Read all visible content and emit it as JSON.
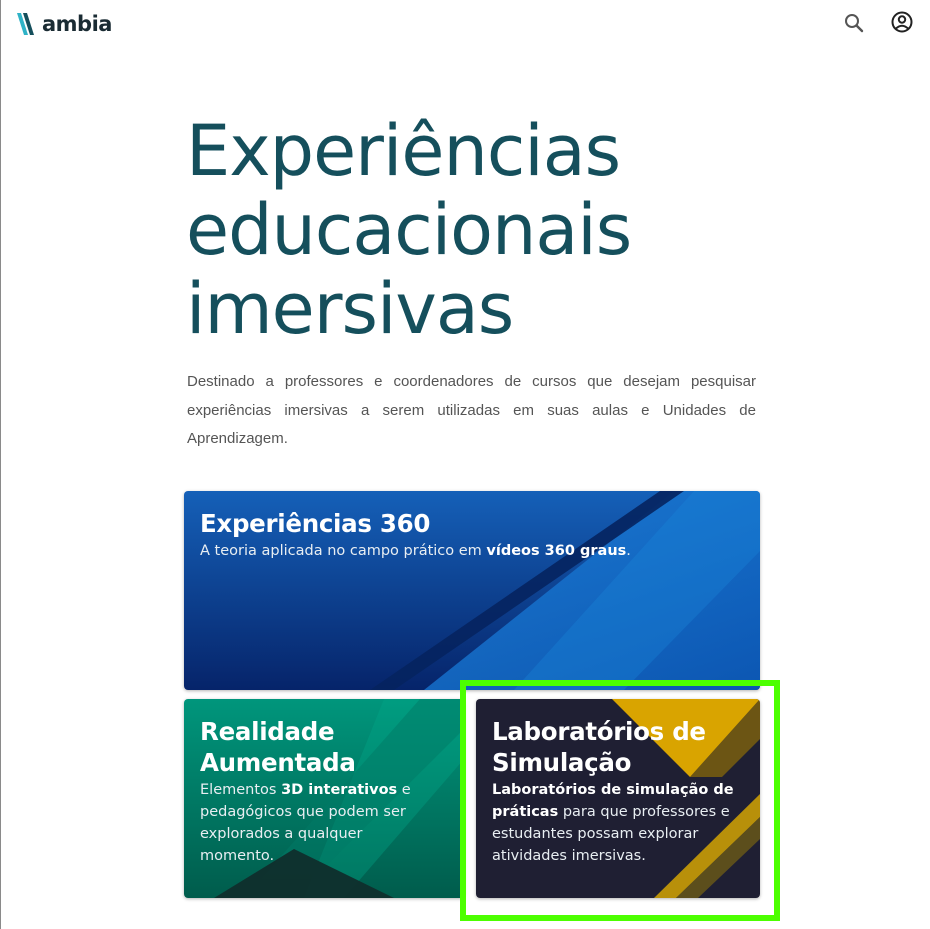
{
  "header": {
    "logo_text": "ambia",
    "icons": {
      "search": "search-icon",
      "user": "account-circle-icon"
    }
  },
  "hero": {
    "title_line1": "Experiências",
    "title_line2": "educacionais",
    "title_line3": "imersivas",
    "description": "Destinado a professores e coordenadores de cursos que desejam pesquisar experiências imersivas a serem utilizadas em suas aulas e Unidades de Aprendizagem."
  },
  "cards": [
    {
      "title": "Experiências 360",
      "text_before": "A teoria aplicada no campo prático em ",
      "text_bold": "vídeos 360 graus",
      "text_after": "."
    },
    {
      "title_line1": "Realidade",
      "title_line2": "Aumentada",
      "text_before": "Elementos ",
      "text_bold": "3D interativos",
      "text_after": " e pedagógicos que podem ser explorados a qualquer momento."
    },
    {
      "title_line1": "Laboratórios de",
      "title_line2": "Simulação",
      "text_bold": "Laboratórios de simulação de práticas",
      "text_after": " para que professores e estudantes possam explorar atividades imersivas."
    }
  ],
  "colors": {
    "title": "#154f5c",
    "card_360": "#0a3f8f",
    "card_ra": "#00806a",
    "card_lab": "#1f1f33",
    "accent_gold": "#d9a400",
    "highlight": "#4cff00"
  }
}
